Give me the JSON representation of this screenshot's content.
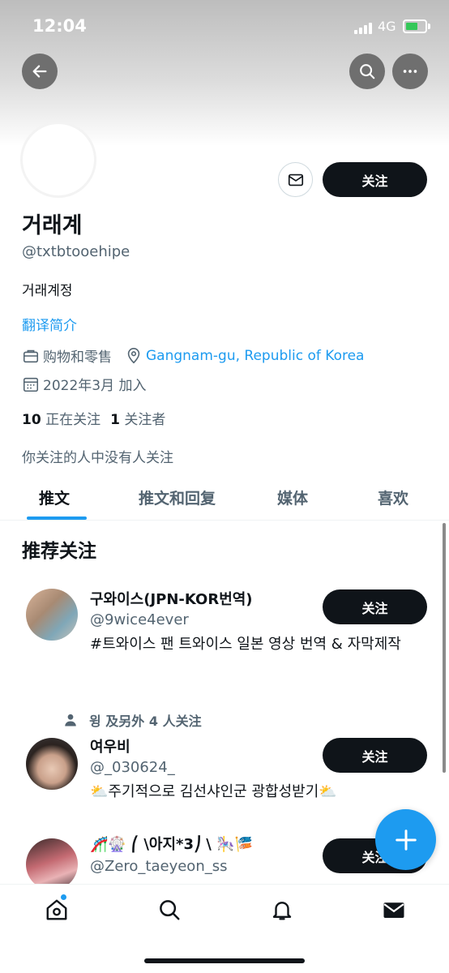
{
  "status_bar": {
    "time": "12:04",
    "network": "4G"
  },
  "profile": {
    "name": "거래계",
    "handle": "@txtbtooehipe",
    "bio": "거래계정",
    "translate_label": "翻译简介",
    "category": "购物和零售",
    "location": "Gangnam-gu, Republic of Korea",
    "joined": "2022年3月 加入",
    "following_count": "10",
    "following_label": "正在关注",
    "followers_count": "1",
    "followers_label": "关注者",
    "mutuals_text": "你关注的人中没有人关注",
    "follow_label": "关注"
  },
  "tabs": [
    {
      "label": "推文",
      "active": true
    },
    {
      "label": "推文和回复",
      "active": false
    },
    {
      "label": "媒体",
      "active": false
    },
    {
      "label": "喜欢",
      "active": false
    }
  ],
  "suggestions": {
    "title": "推荐关注",
    "items": [
      {
        "name": "구와이스(JPN-KOR번역)",
        "handle": "@9wice4ever",
        "bio": "#트와이스 팬 트와이스 일본 영상 번역 & 자막제작",
        "follow_label": "关注"
      },
      {
        "social_context": "윙 及另外 4 人关注",
        "name": "여우비",
        "handle": "@_030624_",
        "bio": "⛅주기적으로 김선샤인군 광합성받기⛅",
        "follow_label": "关注"
      },
      {
        "name": "🎢🎡 ⎛ \\아지*3⎠ \\ 🎠🎏",
        "handle": "@Zero_taeyeon_ss",
        "follow_label": "关注"
      }
    ]
  },
  "colors": {
    "accent": "#1d9bf0",
    "dark": "#0f1419",
    "muted": "#536471"
  },
  "icons": [
    "back-arrow-icon",
    "search-icon",
    "more-icon",
    "mail-icon",
    "briefcase-icon",
    "location-icon",
    "calendar-icon",
    "person-icon",
    "plus-icon",
    "home-icon",
    "bell-icon",
    "envelope-icon"
  ]
}
